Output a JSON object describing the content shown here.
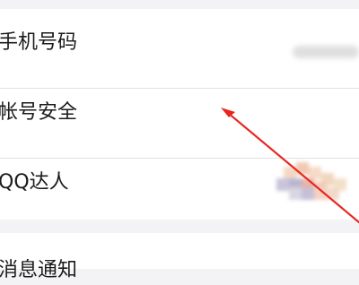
{
  "settings": {
    "rows": [
      {
        "label": "手机号码",
        "value_hidden": true
      },
      {
        "label": "帐号安全"
      },
      {
        "label": "QQ达人",
        "value_hidden": true
      }
    ],
    "next_section_label": "消息通知"
  },
  "colors": {
    "background": "#f3f3f5",
    "panel": "#ffffff",
    "divider": "#e2e2e4",
    "text": "#1b1b1b",
    "arrow": "#e8261f"
  },
  "annotation": {
    "type": "arrow",
    "icon": "red-arrow"
  }
}
